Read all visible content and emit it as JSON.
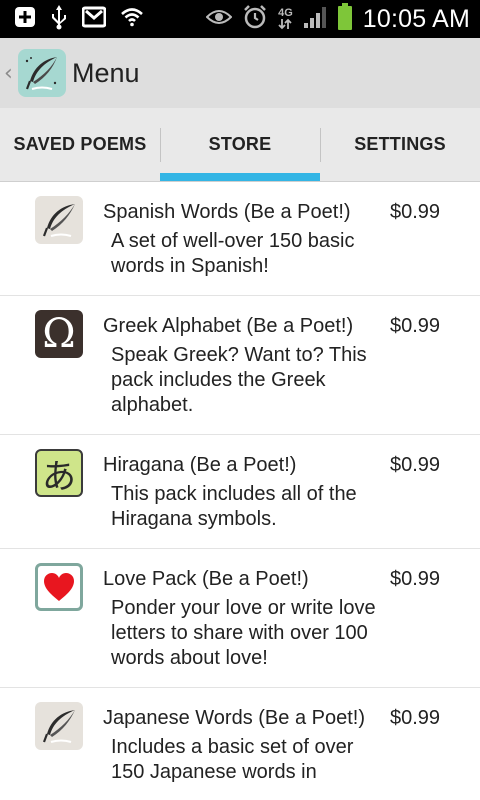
{
  "status_bar": {
    "time": "10:05 AM",
    "network_label": "4G",
    "left_icons": [
      "add-icon",
      "usb-icon",
      "email-icon",
      "wifi-icon"
    ],
    "right_icons": [
      "eye-icon",
      "alarm-icon",
      "signal-icon",
      "battery-icon"
    ]
  },
  "action_bar": {
    "title": "Menu",
    "icon": "quill-icon"
  },
  "tabs": [
    {
      "label": "SAVED POEMS",
      "active": false
    },
    {
      "label": "STORE",
      "active": true
    },
    {
      "label": "SETTINGS",
      "active": false
    }
  ],
  "accent_color": "#33b5e5",
  "store_items": [
    {
      "icon": "quill-icon",
      "title": "Spanish Words (Be a Poet!)",
      "description": "A set of well-over 150 basic words in Spanish!",
      "price": "$0.99"
    },
    {
      "icon": "omega-icon",
      "icon_glyph": "Ω",
      "title": "Greek Alphabet (Be a Poet!)",
      "description": "Speak Greek? Want to? This pack includes the Greek alphabet.",
      "price": "$0.99"
    },
    {
      "icon": "hiragana-icon",
      "icon_glyph": "あ",
      "title": "Hiragana (Be a Poet!)",
      "description": "This pack includes all of the Hiragana symbols.",
      "price": "$0.99"
    },
    {
      "icon": "heart-icon",
      "title": "Love Pack (Be a Poet!)",
      "description": "Ponder your love or write love letters to share with over 100 words about love!",
      "price": "$0.99"
    },
    {
      "icon": "quill-icon",
      "title": "Japanese Words (Be a Poet!)",
      "description": "Includes a basic set of over 150 Japanese words in",
      "price": "$0.99"
    }
  ]
}
